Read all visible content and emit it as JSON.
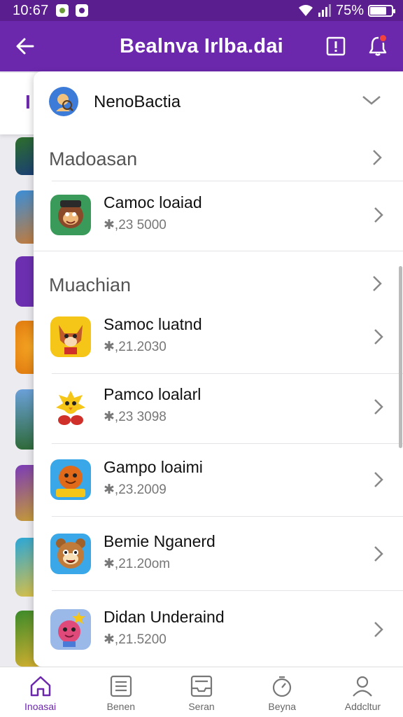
{
  "status_bar": {
    "time": "10:67",
    "battery": "75%",
    "battery_level": 0.75
  },
  "app_bar": {
    "title": "Bealnva Irlba.dai"
  },
  "background": {
    "tab_fragment": "I"
  },
  "dropdown": {
    "account_name": "NenoBactia",
    "sections": [
      {
        "label": "Madoasan"
      },
      {
        "label": "Muachian"
      }
    ],
    "games": [
      {
        "title": "Camoc loaiad",
        "price": "✱,23 5000",
        "icon": "monkey-icon"
      },
      {
        "title": "Samoc luatnd",
        "price": "✱,21.2030",
        "icon": "fox-icon"
      },
      {
        "title": "Pamco loalarl",
        "price": "✱,23 3098",
        "icon": "chick-icon"
      },
      {
        "title": "Gampo loaimi",
        "price": "✱,23.2009",
        "icon": "orange-critter-icon"
      },
      {
        "title": "Bemie Nganerd",
        "price": "✱,21.20om",
        "icon": "bear-icon"
      },
      {
        "title": "Didan Underaind",
        "price": "✱,21.5200",
        "icon": "pink-creature-icon"
      }
    ]
  },
  "bottom_nav": {
    "items": [
      {
        "label": "Inoasai",
        "icon": "home-icon",
        "active": true
      },
      {
        "label": "Benen",
        "icon": "list-icon",
        "active": false
      },
      {
        "label": "Seran",
        "icon": "inbox-icon",
        "active": false
      },
      {
        "label": "Beyna",
        "icon": "timer-icon",
        "active": false
      },
      {
        "label": "Addcltur",
        "icon": "person-icon",
        "active": false
      }
    ]
  },
  "colors": {
    "status_bar": "#5a1e8e",
    "app_bar": "#6c28ad",
    "accent": "#6c28ad",
    "badge": "#f4433c"
  }
}
